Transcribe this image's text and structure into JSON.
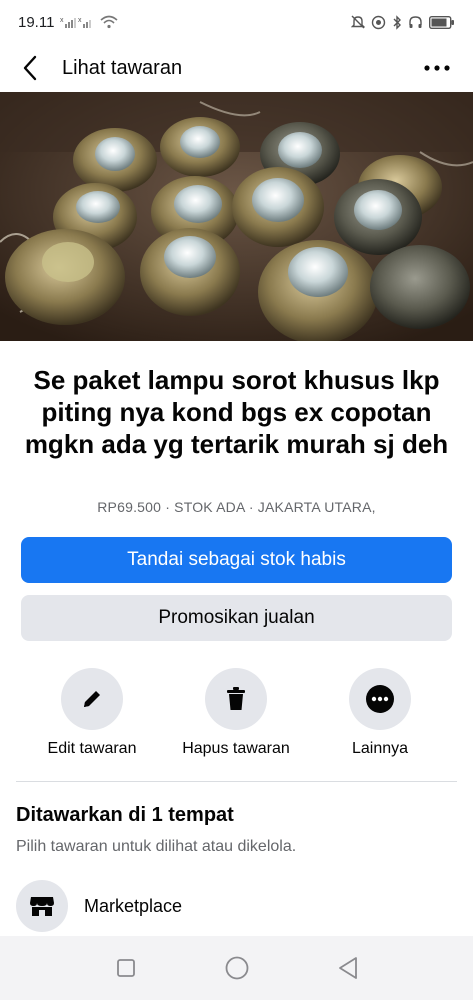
{
  "status_bar": {
    "time": "19.11"
  },
  "top_bar": {
    "title": "Lihat tawaran"
  },
  "hero": {
    "image_count": 6,
    "active_index": 0
  },
  "listing": {
    "title": "Se paket lampu sorot khusus lkp piting nya kond bgs ex copotan mgkn ada yg tertarik murah sj deh",
    "meta": "RP69.500 · STOK ADA · JAKARTA UTARA,"
  },
  "buttons": {
    "primary_label": "Tandai sebagai stok habis",
    "secondary_label": "Promosikan jualan"
  },
  "actions": [
    {
      "label": "Edit tawaran",
      "icon": "pencil-icon"
    },
    {
      "label": "Hapus tawaran",
      "icon": "trash-icon"
    },
    {
      "label": "Lainnya",
      "icon": "more-horizontal-icon"
    }
  ],
  "offered": {
    "title": "Ditawarkan di 1 tempat",
    "subtitle": "Pilih tawaran untuk dilihat atau dikelola.",
    "places": [
      {
        "label": "Marketplace",
        "icon": "storefront-icon"
      }
    ]
  },
  "colors": {
    "primary": "#1877f2",
    "secondary_bg": "#e4e6eb",
    "muted_text": "#65676b"
  }
}
